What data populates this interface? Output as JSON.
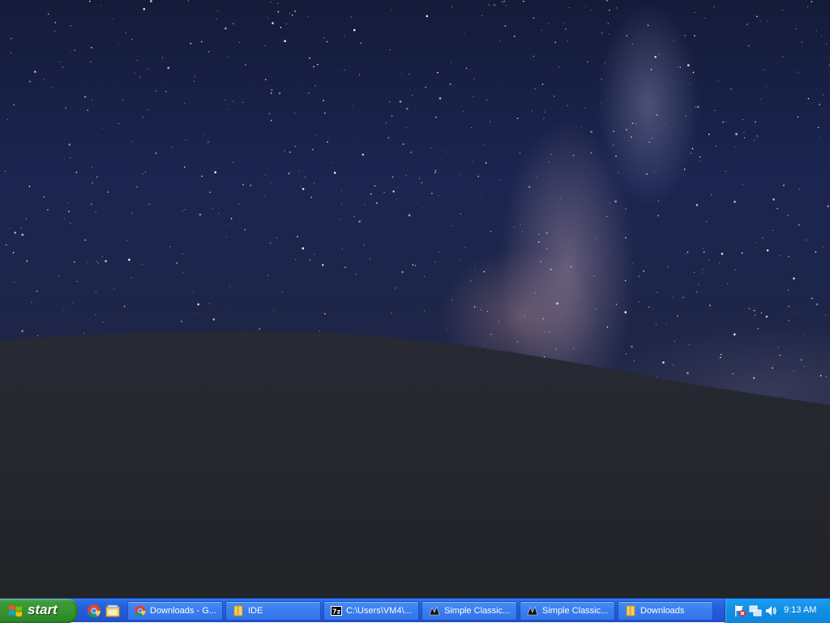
{
  "desktop": {
    "wallpaper": "night-sky-milky-way-over-hill"
  },
  "taskbar": {
    "start_label": "start",
    "quick_launch": [
      {
        "name": "chrome-icon"
      },
      {
        "name": "explorer-icon"
      }
    ],
    "tasks": [
      {
        "label": "Downloads - G...",
        "icon": "chrome-icon"
      },
      {
        "label": "IDE",
        "icon": "folder-icon"
      },
      {
        "label": "C:\\Users\\VM4\\...",
        "icon": "7zip-icon"
      },
      {
        "label": "Simple Classic...",
        "icon": "app-icon"
      },
      {
        "label": "Simple Classic...",
        "icon": "app-icon"
      },
      {
        "label": "Downloads",
        "icon": "folder-icon"
      }
    ],
    "tray": {
      "icons": [
        "flag-icon",
        "network-icon",
        "volume-icon"
      ],
      "clock": "9:13 AM"
    }
  },
  "colors": {
    "taskbar_blue": "#245edb",
    "start_green": "#36942f",
    "tray_blue": "#1290e6"
  }
}
